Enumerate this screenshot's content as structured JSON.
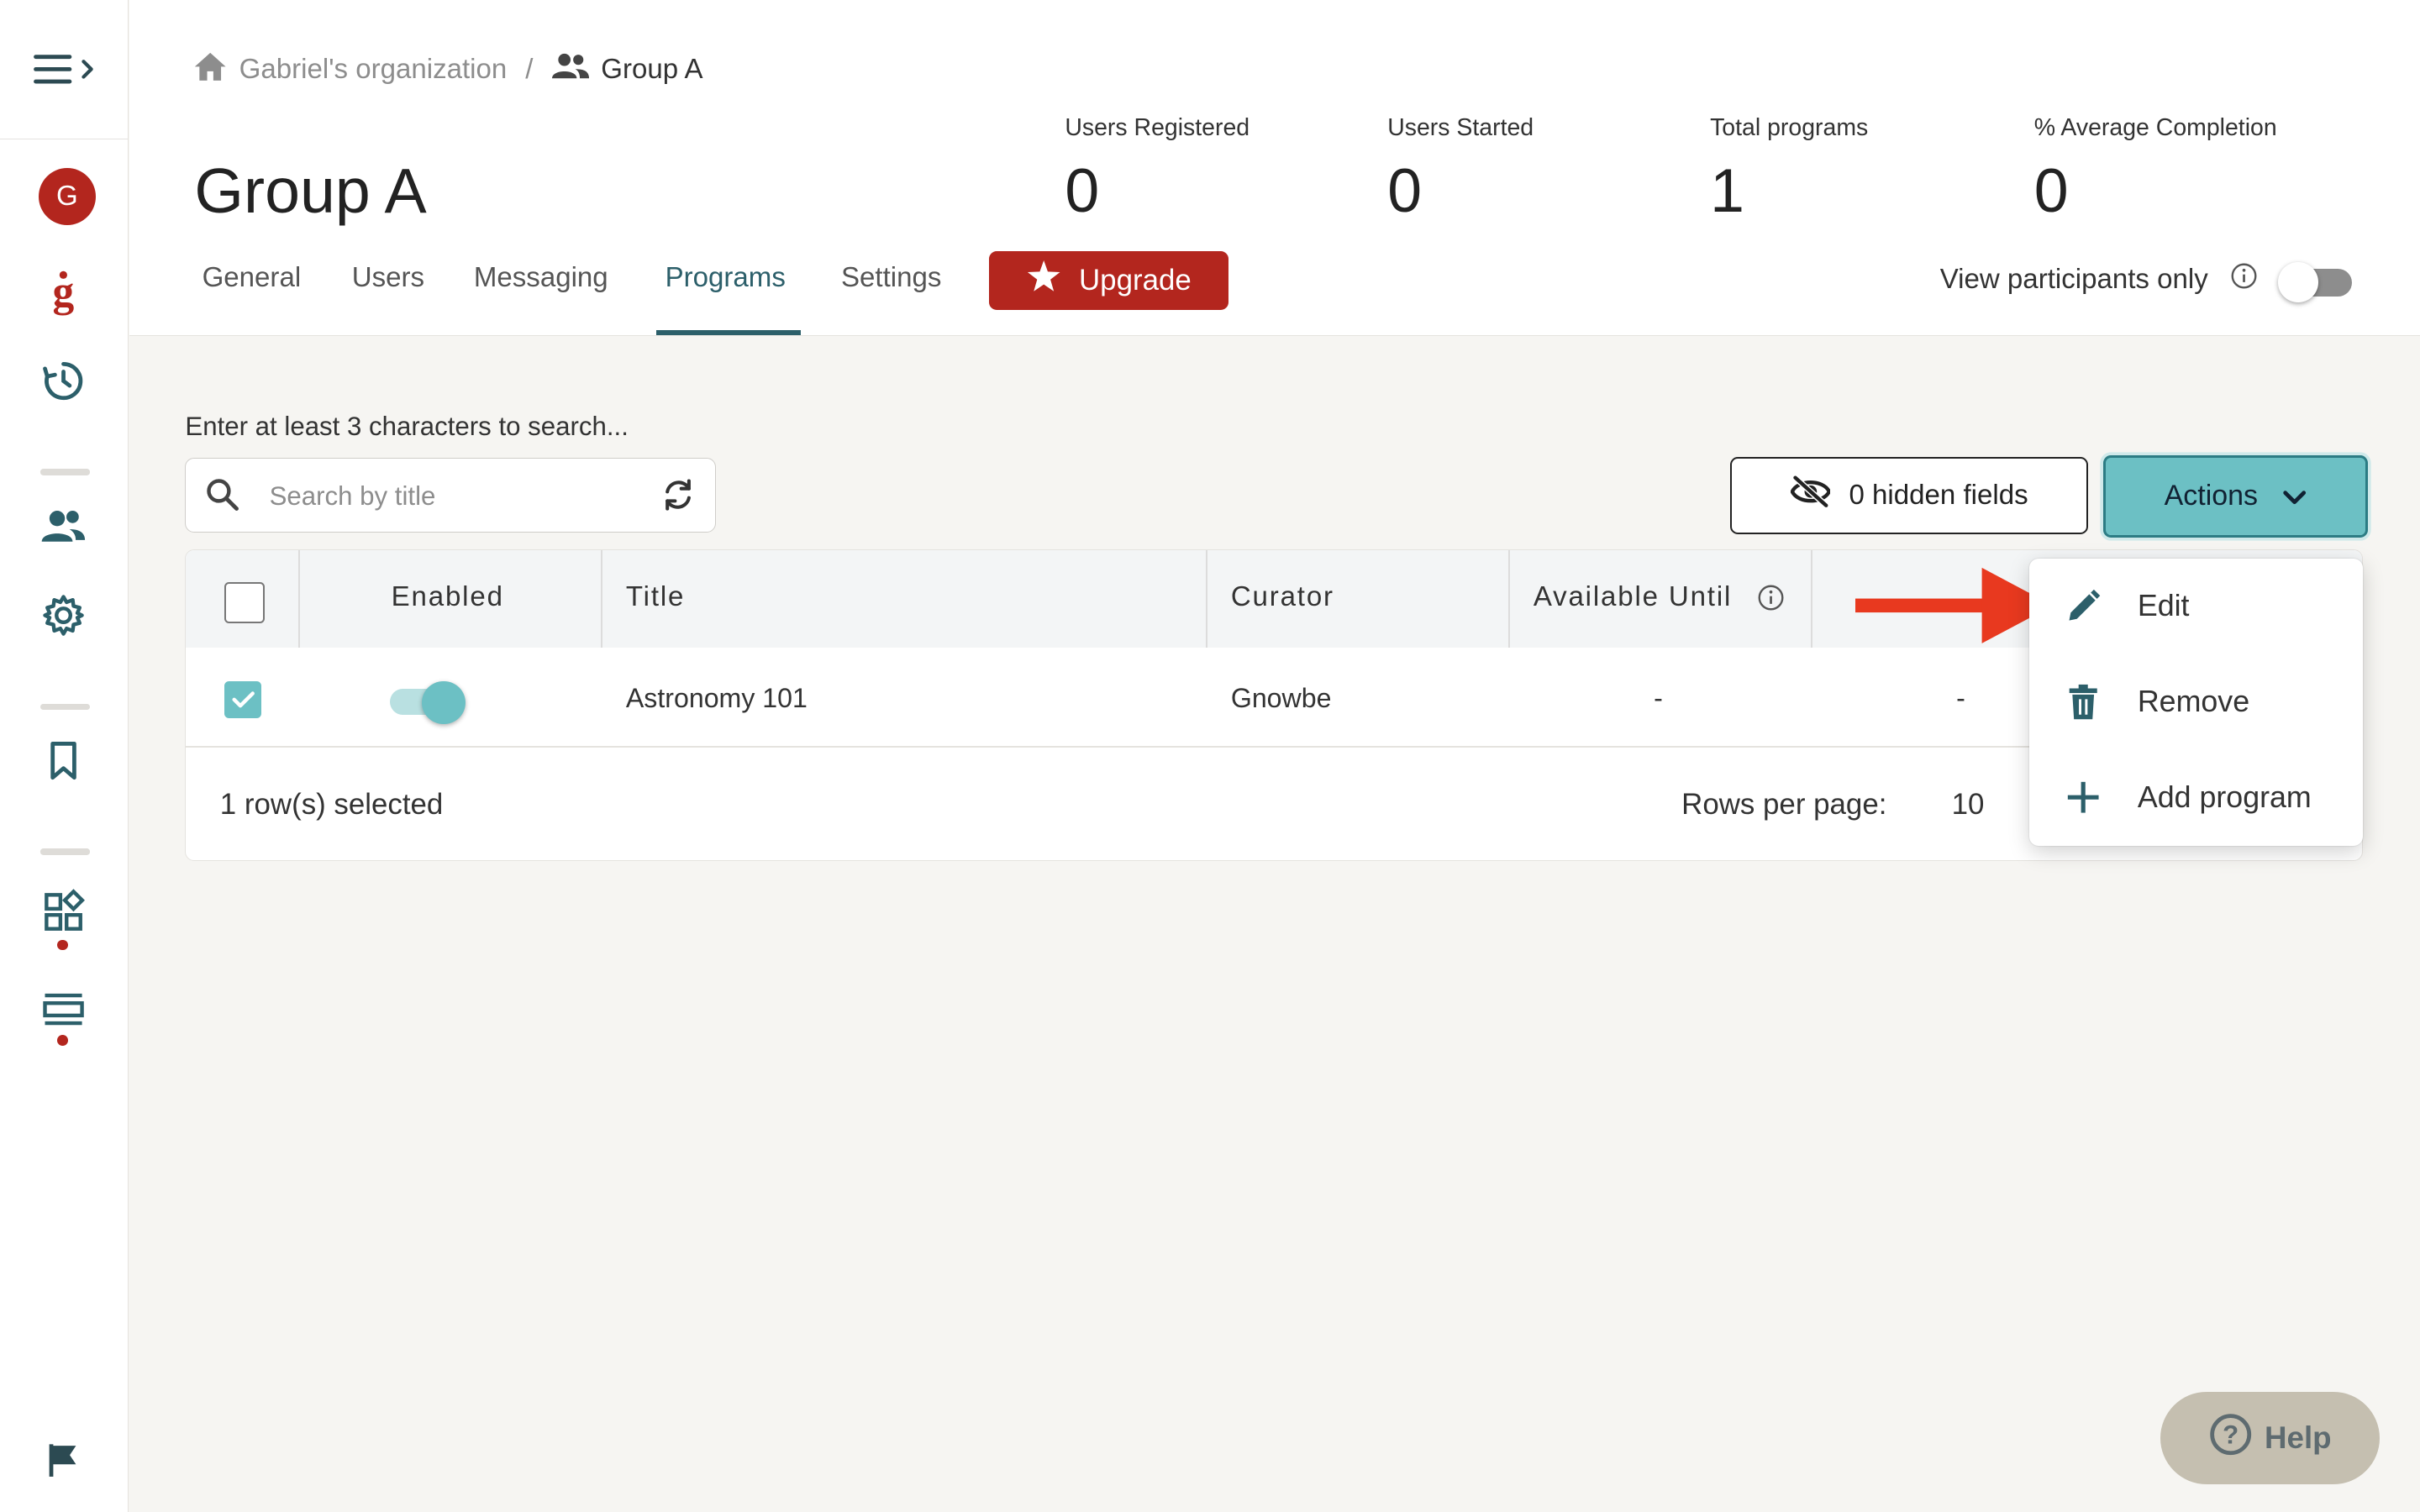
{
  "breadcrumb": {
    "org": "Gabriel's organization",
    "separator": "/",
    "group": "Group A"
  },
  "page_title": "Group A",
  "avatar_letter": "G",
  "stats": [
    {
      "label": "Users Registered",
      "value": "0"
    },
    {
      "label": "Users Started",
      "value": "0"
    },
    {
      "label": "Total programs",
      "value": "1"
    },
    {
      "label": "% Average Completion",
      "value": "0"
    }
  ],
  "tabs": [
    {
      "label": "General",
      "active": false
    },
    {
      "label": "Users",
      "active": false
    },
    {
      "label": "Messaging",
      "active": false
    },
    {
      "label": "Programs",
      "active": true
    },
    {
      "label": "Settings",
      "active": false
    }
  ],
  "upgrade_label": "Upgrade",
  "view_participants": {
    "label": "View participants only",
    "enabled": false
  },
  "search": {
    "hint": "Enter at least 3 characters to search...",
    "placeholder": "Search by title",
    "value": ""
  },
  "hidden_fields_label": "0 hidden fields",
  "actions_label": "Actions",
  "table": {
    "columns": [
      "Enabled",
      "Title",
      "Curator",
      "Available Until"
    ],
    "rows": [
      {
        "selected": true,
        "enabled": true,
        "title": "Astronomy 101",
        "curator": "Gnowbe",
        "available_until": "-",
        "extra": "-"
      }
    ],
    "selection_text": "1 row(s) selected",
    "rows_per_page_label": "Rows per page:",
    "rows_per_page": "10"
  },
  "actions_menu": [
    {
      "label": "Edit",
      "icon": "pencil-icon"
    },
    {
      "label": "Remove",
      "icon": "trash-icon"
    },
    {
      "label": "Add program",
      "icon": "plus-icon"
    }
  ],
  "help_label": "Help",
  "colors": {
    "brand_red": "#b3261e",
    "teal_dark": "#2c5f6a",
    "teal_accent": "#6cc0c4",
    "annotation_arrow": "#e8391f"
  }
}
